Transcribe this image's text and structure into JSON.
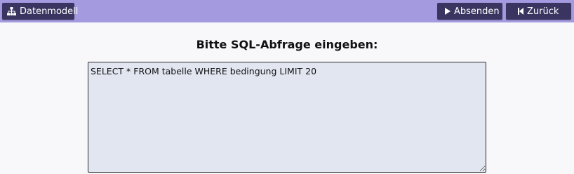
{
  "toolbar": {
    "datenmodell_label": "Datenmodell",
    "datenmodell_icon": "sitemap-icon",
    "absenden_label": "Absenden",
    "absenden_icon": "play-icon",
    "zurueck_label": "Zurück",
    "zurueck_icon": "skip-back-icon"
  },
  "main": {
    "prompt": "Bitte SQL-Abfrage eingeben:",
    "query_value": "SELECT * FROM tabelle WHERE bedingung LIMIT 20"
  },
  "colors": {
    "topbar": "#a39ae0",
    "button": "#3a3560",
    "editor_bg": "#e2e6f1",
    "page_bg": "#f8f8fb"
  }
}
